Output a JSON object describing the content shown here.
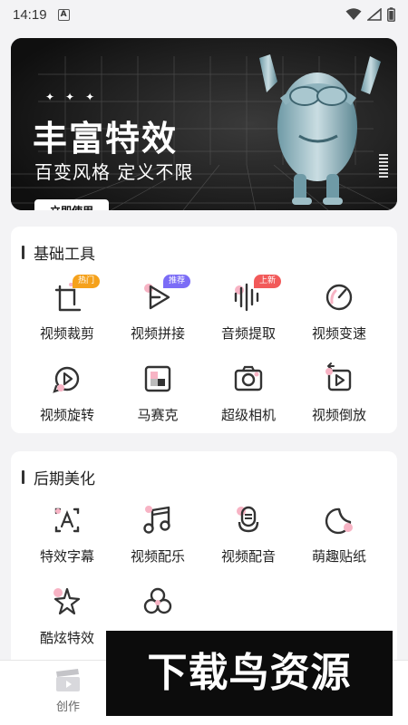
{
  "status_bar": {
    "time": "14:19",
    "notification_badge": "A"
  },
  "banner": {
    "title": "丰富特效",
    "subtitle": "百变风格 定义不限",
    "cta_label": "立即使用",
    "sparkles": "✦✦✦"
  },
  "sections": {
    "basic": {
      "title": "基础工具",
      "tools": [
        {
          "label": "视频裁剪",
          "icon": "crop-icon",
          "tag": "热门",
          "tag_color": "#f5a11b"
        },
        {
          "label": "视频拼接",
          "icon": "play-splice-icon",
          "tag": "推荐",
          "tag_color": "#7b6cf6"
        },
        {
          "label": "音频提取",
          "icon": "audio-wave-icon",
          "tag": "上新",
          "tag_color": "#f25a5a"
        },
        {
          "label": "视频变速",
          "icon": "speedometer-icon"
        },
        {
          "label": "视频旋转",
          "icon": "rotate-play-icon"
        },
        {
          "label": "马赛克",
          "icon": "mosaic-icon"
        },
        {
          "label": "超级相机",
          "icon": "camera-icon"
        },
        {
          "label": "视频倒放",
          "icon": "reverse-play-icon"
        }
      ]
    },
    "post": {
      "title": "后期美化",
      "tools": [
        {
          "label": "特效字幕",
          "icon": "subtitle-icon"
        },
        {
          "label": "视频配乐",
          "icon": "music-note-icon"
        },
        {
          "label": "视频配音",
          "icon": "microphone-icon"
        },
        {
          "label": "萌趣贴纸",
          "icon": "sticker-icon"
        },
        {
          "label": "酷炫特效",
          "icon": "sparkle-star-icon"
        },
        {
          "label": "",
          "icon": "circles-filter-icon"
        }
      ]
    }
  },
  "bottom_nav": {
    "create_label": "创作"
  },
  "watermark": "下载鸟资源",
  "colors": {
    "accent_pink": "#f7b3c4",
    "icon_stroke": "#333333",
    "background": "#f3f3f5"
  }
}
